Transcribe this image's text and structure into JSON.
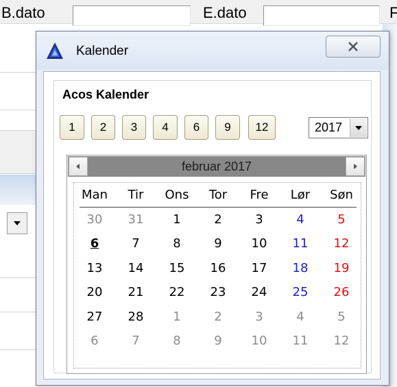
{
  "background": {
    "b_dato_label": "B.dato",
    "e_dato_label": "E.dato",
    "cut_label": "F"
  },
  "dialog": {
    "title": "Kalender",
    "group_title": "Acos Kalender",
    "shortcuts": [
      "1",
      "2",
      "3",
      "4",
      "6",
      "9",
      "12"
    ],
    "year": "2017",
    "calendar": {
      "month_label": "februar 2017",
      "weekdays": [
        "Man",
        "Tir",
        "Ons",
        "Tor",
        "Fre",
        "Lør",
        "Søn"
      ],
      "weeks": [
        [
          "30",
          "31",
          "1",
          "2",
          "3",
          "4",
          "5"
        ],
        [
          "6",
          "7",
          "8",
          "9",
          "10",
          "11",
          "12"
        ],
        [
          "13",
          "14",
          "15",
          "16",
          "17",
          "18",
          "19"
        ],
        [
          "20",
          "21",
          "22",
          "23",
          "24",
          "25",
          "26"
        ],
        [
          "27",
          "28",
          "1",
          "2",
          "3",
          "4",
          "5"
        ],
        [
          "6",
          "7",
          "8",
          "9",
          "10",
          "11",
          "12"
        ]
      ],
      "today": "6",
      "colors": {
        "saturday": "#1a1adb",
        "sunday": "#e01010",
        "other_month": "#8c8c8c",
        "header_bar": "#888888"
      }
    }
  },
  "icons": {
    "app": "acos-logo-icon",
    "close": "close-icon",
    "prev": "chevron-left-icon",
    "next": "chevron-right-icon",
    "dropdown": "chevron-down-icon"
  }
}
